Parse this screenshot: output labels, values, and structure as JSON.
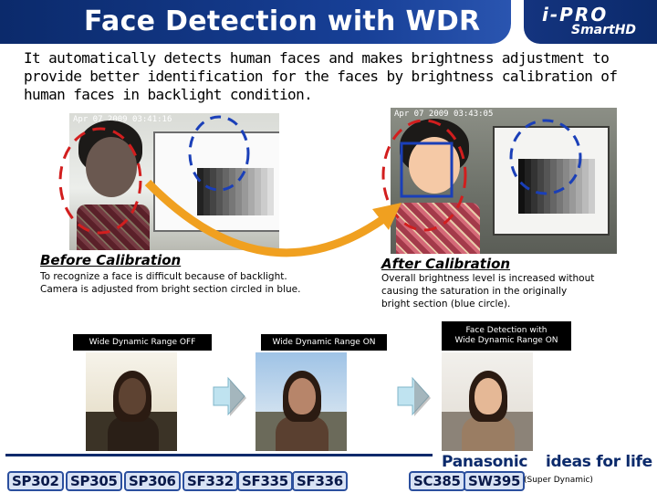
{
  "header": {
    "title": "Face Detection with WDR",
    "brand_logo": "i-PRO",
    "brand_sub": "SmartHD"
  },
  "intro": "It automatically detects human faces and makes brightness adjustment to provide better identification for the faces by brightness calibration of human faces in backlight condition.",
  "before": {
    "timestamp": "Apr 07 2009 03:41:16",
    "title": "Before Calibration",
    "caption_line1": "To recognize a face is difficult because of backlight.",
    "caption_line2": "Camera is adjusted from bright section circled in blue."
  },
  "after": {
    "timestamp": "Apr 07 2009 03:43:05",
    "title": "After Calibration",
    "caption_line1": "Overall brightness level is increased without",
    "caption_line2": "causing the saturation in the originally",
    "caption_line3": "bright section (blue circle)."
  },
  "steps": [
    {
      "label": "Wide Dynamic Range OFF"
    },
    {
      "label": "Wide Dynamic Range ON"
    },
    {
      "label_line1": "Face Detection with",
      "label_line2": "Wide Dynamic Range ON"
    }
  ],
  "footer": {
    "brand": "Panasonic",
    "slogan": "ideas for life",
    "models_left": [
      "SP302",
      "SP305",
      "SP306",
      "SF332",
      "SF335",
      "SF336"
    ],
    "models_right": [
      "SC385",
      "SW395"
    ],
    "note": "(Super Dynamic)"
  },
  "colors": {
    "title_blue": "#0b2a6b",
    "circle_red": "#d21e1e",
    "circle_blue": "#1a3fb8",
    "arrow_orange": "#f0a020",
    "model_bg": "#d9e3f5"
  }
}
